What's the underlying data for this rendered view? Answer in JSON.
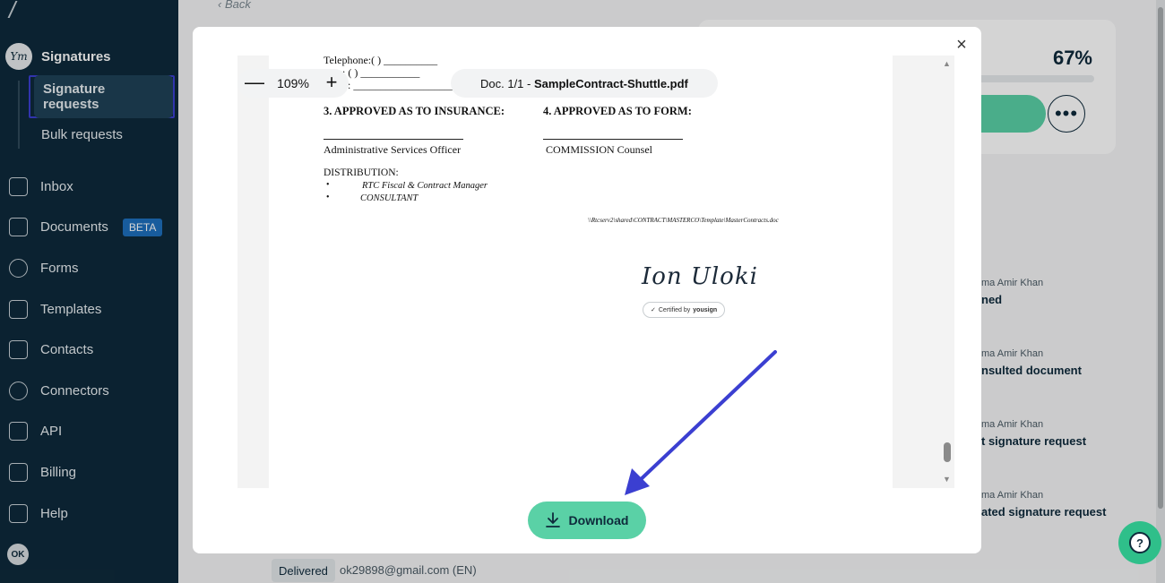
{
  "sidebar": {
    "logo": "/",
    "section_title": "Signatures",
    "section_avatar": "Ym",
    "sub_items": [
      "Signature requests",
      "Bulk requests"
    ],
    "nav": [
      {
        "label": "Inbox",
        "icon": "inbox-icon"
      },
      {
        "label": "Documents",
        "icon": "document-icon",
        "badge": "BETA"
      },
      {
        "label": "Forms",
        "icon": "forms-icon"
      },
      {
        "label": "Templates",
        "icon": "template-icon"
      },
      {
        "label": "Contacts",
        "icon": "contacts-icon"
      },
      {
        "label": "Connectors",
        "icon": "connectors-icon"
      },
      {
        "label": "API",
        "icon": "api-icon"
      },
      {
        "label": "Billing",
        "icon": "billing-icon"
      },
      {
        "label": "Help",
        "icon": "help-icon"
      }
    ],
    "user_initials": "OK"
  },
  "background": {
    "back_label": "Back",
    "progress_percent": "67%",
    "progress_fraction": 0.67,
    "more_label": "•••",
    "activity": [
      {
        "who": "ma Amir Khan",
        "what": "ned"
      },
      {
        "who": "ma Amir Khan",
        "what": "nsulted document"
      },
      {
        "who": "ma Amir Khan",
        "what": "t signature request"
      },
      {
        "who": "ma Amir Khan",
        "what": "ated signature request"
      }
    ],
    "status_badge": "Delivered",
    "signer_email": "ok29898@gmail.com (EN)"
  },
  "modal": {
    "close_label": "×",
    "zoom_out_label": "—",
    "zoom_value": "109%",
    "zoom_in_label": "+",
    "doc_counter": "Doc. 1/1 - ",
    "doc_name": "SampleContract-Shuttle.pdf",
    "download_label": "Download"
  },
  "document": {
    "telephone": "Telephone:(          )  __________",
    "fax": "x: (          )  ___________",
    "email": "ail:  ____________________",
    "section3": "3. APPROVED AS TO INSURANCE:",
    "section4": "4. APPROVED AS TO FORM:",
    "officer": "Administrative Services Officer",
    "counsel": "COMMISSION Counsel",
    "distribution": "DISTRIBUTION:",
    "bullet1": "RTC Fiscal & Contract Manager",
    "bullet2": "CONSULTANT",
    "path": "\\\\Rtcserv2\\shared\\CONTRACT\\MASTERCO\\Template\\MasterContracts.doc",
    "signature": "Ion Uloki",
    "certified": "Certified by",
    "certified_brand": "yousign"
  },
  "colors": {
    "sidebar_bg": "#0e2a3b",
    "accent_green": "#5ad1a6",
    "highlight_border": "#3b3fd1",
    "arrow": "#3b3fd1",
    "beta_badge": "#1e6fbd"
  }
}
